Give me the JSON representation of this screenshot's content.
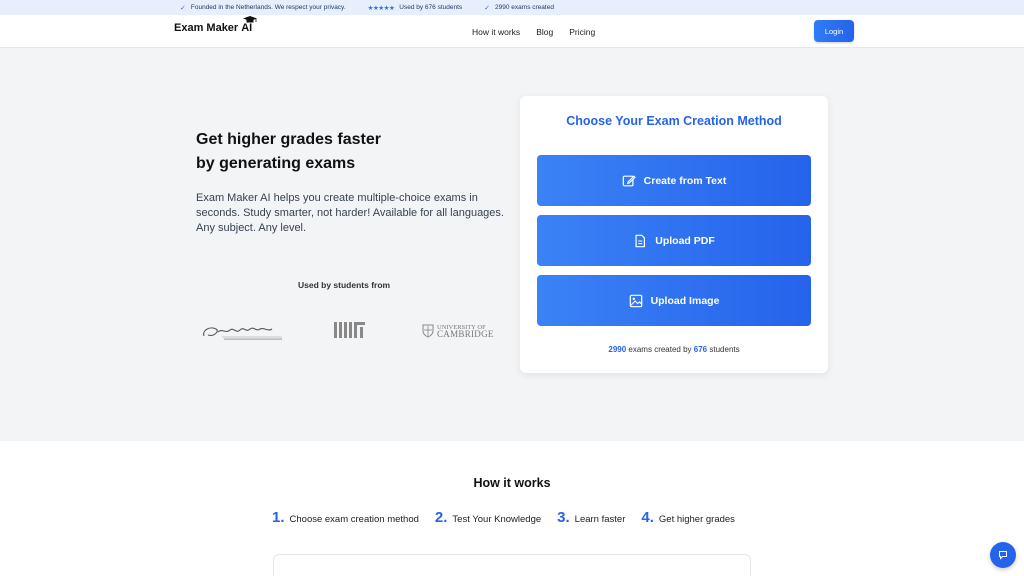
{
  "topbar": {
    "items": [
      {
        "text": "Founded in the Netherlands. We respect your privacy."
      },
      {
        "stars": "★★★★★",
        "text": "Used by 676 students"
      },
      {
        "text": "2990 exams created"
      }
    ]
  },
  "nav": {
    "logo_text": "Exam Maker",
    "logo_ai": "AI",
    "links": [
      "How it works",
      "Blog",
      "Pricing"
    ],
    "login_label": "Login"
  },
  "hero": {
    "headline_line1": "Get higher grades faster",
    "headline_line2": "by generating exams",
    "description": "Exam Maker AI helps you create multiple-choice exams in seconds. Study smarter, not harder! Available for all languages. Any subject. Any level.",
    "used_by": "Used by students from",
    "logos": {
      "cambridge_line1": "UNIVERSITY OF",
      "cambridge_line2": "CAMBRIDGE"
    }
  },
  "card": {
    "title": "Choose Your Exam Creation Method",
    "buttons": [
      {
        "label": "Create from Text",
        "icon": "edit-icon"
      },
      {
        "label": "Upload PDF",
        "icon": "file-icon"
      },
      {
        "label": "Upload Image",
        "icon": "image-icon"
      }
    ],
    "stats": {
      "exams": "2990",
      "mid": "exams created by",
      "students": "676",
      "end": "students"
    }
  },
  "how": {
    "title": "How it works",
    "steps": [
      {
        "n": "1.",
        "label": "Choose exam creation method"
      },
      {
        "n": "2.",
        "label": "Test Your Knowledge"
      },
      {
        "n": "3.",
        "label": "Learn faster"
      },
      {
        "n": "4.",
        "label": "Get higher grades"
      }
    ]
  },
  "colors": {
    "accent": "#2563eb",
    "topbar_bg": "#e6effb",
    "hero_bg": "#f3f4f6"
  }
}
